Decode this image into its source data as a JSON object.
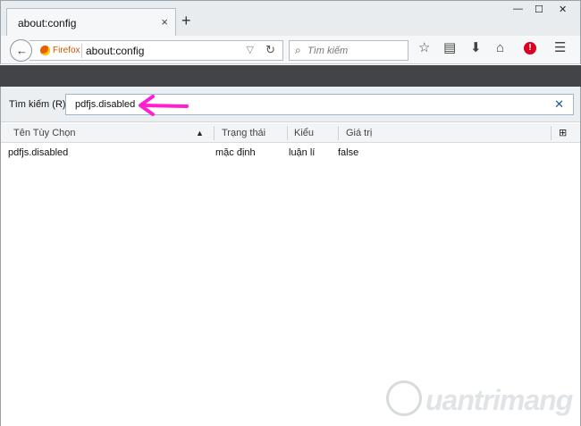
{
  "tab": {
    "title": "about:config",
    "close": "×"
  },
  "new_tab_label": "+",
  "window_controls": {
    "minimize": "—",
    "maximize": "☐",
    "close": "✕"
  },
  "navbar": {
    "back_glyph": "←",
    "identity_label": "Firefox",
    "url": "about:config",
    "dropdown_glyph": "▽",
    "reload_glyph": "↻",
    "search_placeholder": "Tìm kiếm",
    "search_glyph": "⌕",
    "toolbar": [
      {
        "name": "bookmark-star-icon",
        "glyph": "☆"
      },
      {
        "name": "reading-list-icon",
        "glyph": "▤"
      },
      {
        "name": "downloads-icon",
        "glyph": "⬇"
      },
      {
        "name": "home-icon",
        "glyph": "⌂"
      },
      {
        "name": "menu-icon",
        "glyph": "☰"
      }
    ],
    "alert_glyph": "!"
  },
  "filter": {
    "label": "Tìm kiếm (R):",
    "value": "pdfjs.disabled",
    "clear_glyph": "✕"
  },
  "columns": {
    "name": "Tên Tùy Chọn",
    "status": "Trạng thái",
    "type": "Kiểu",
    "value": "Giá trị",
    "sort_glyph": "▲",
    "picker_glyph": "⊞"
  },
  "rows": [
    {
      "name": "pdfjs.disabled",
      "status": "mặc định",
      "type": "luận lí",
      "value": "false"
    }
  ],
  "colors": {
    "arrow": "#ff1fd0",
    "dark_band": "#424447"
  },
  "watermark": {
    "text": "uantrimang"
  }
}
